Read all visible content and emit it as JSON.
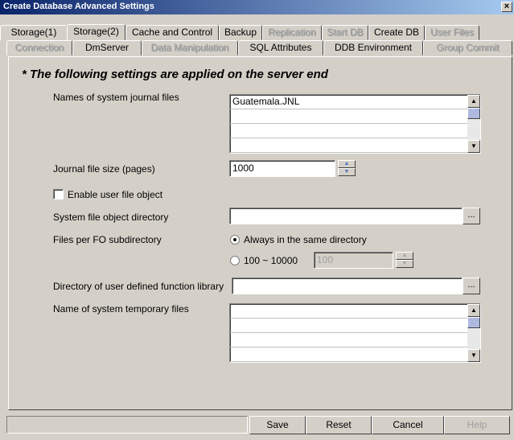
{
  "window": {
    "title": "Create Database Advanced Settings",
    "close_label": "×"
  },
  "tabs_row1": [
    {
      "label": "Storage(1)",
      "enabled": true
    },
    {
      "label": "Storage(2)",
      "enabled": true,
      "active": true
    },
    {
      "label": "Cache and Control",
      "enabled": true
    },
    {
      "label": "Backup",
      "enabled": true
    },
    {
      "label": "Replication",
      "enabled": false
    },
    {
      "label": "Start DB",
      "enabled": false
    },
    {
      "label": "Create DB",
      "enabled": true
    },
    {
      "label": "User Files",
      "enabled": false
    }
  ],
  "tabs_row2": [
    {
      "label": "Connection",
      "enabled": false
    },
    {
      "label": "DmServer",
      "enabled": true
    },
    {
      "label": "Data Manipulation",
      "enabled": false
    },
    {
      "label": "SQL Attributes",
      "enabled": true
    },
    {
      "label": "DDB Environment",
      "enabled": true
    },
    {
      "label": "Group Commit",
      "enabled": false
    }
  ],
  "header": "* The following settings are applied on the server end",
  "journal": {
    "label": "Names of system journal files",
    "rows": [
      "Guatemala.JNL",
      "",
      "",
      ""
    ]
  },
  "journal_size": {
    "label": "Journal file size (pages)",
    "value": "1000"
  },
  "user_file_object": {
    "label": "Enable user file object",
    "checked": false
  },
  "fo_directory": {
    "label": "System file object directory",
    "value": "",
    "browse_label": "..."
  },
  "fo_subdir": {
    "label": "Files per FO subdirectory",
    "option1": "Always in the same directory",
    "option2": "100 ~ 10000",
    "option2_value": "100",
    "selected": "option1"
  },
  "udf_library": {
    "label": "Directory of user defined function library",
    "value": "",
    "browse_label": "..."
  },
  "temp_files": {
    "label": "Name of system temporary files",
    "rows": [
      "",
      "",
      "",
      ""
    ]
  },
  "buttons": {
    "save": "Save",
    "reset": "Reset",
    "cancel": "Cancel",
    "help": "Help"
  }
}
